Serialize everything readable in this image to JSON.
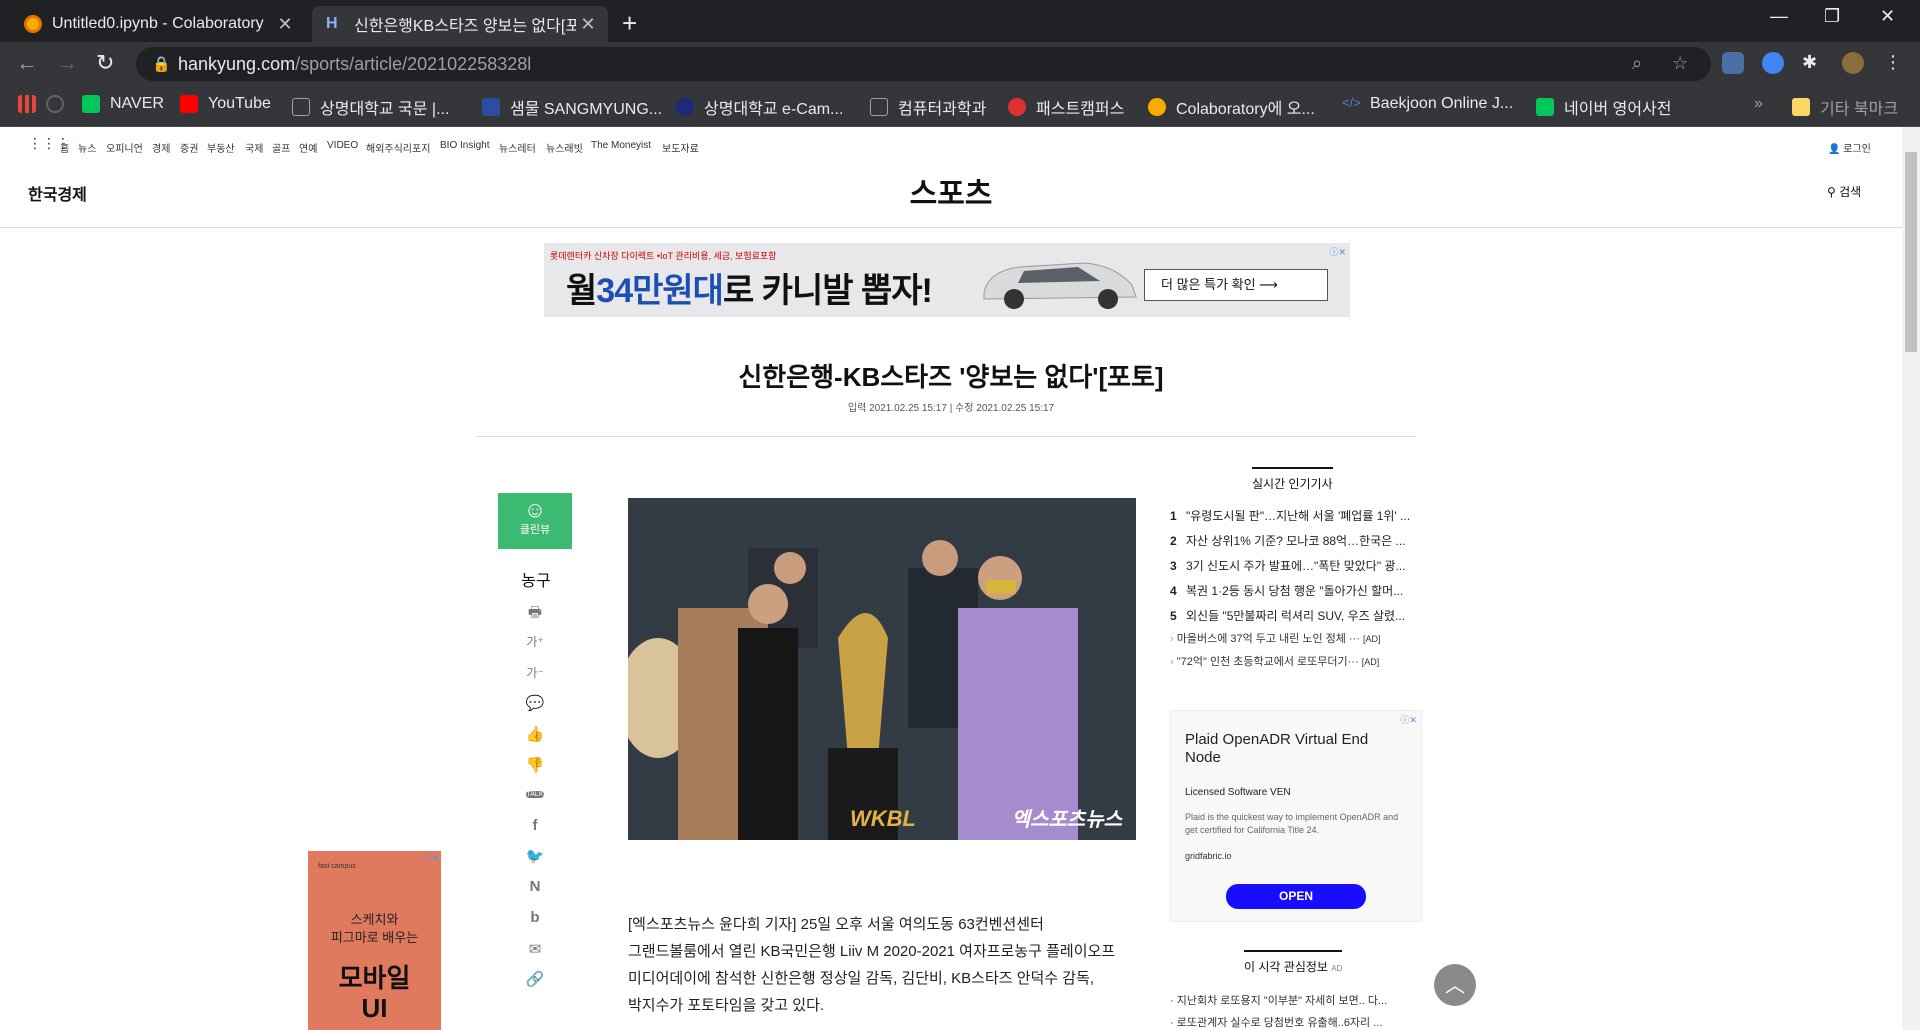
{
  "browser": {
    "tabs": [
      {
        "title": "Untitled0.ipynb - Colaboratory",
        "active": false,
        "favicon": "colab-icon"
      },
      {
        "title": "신한은행KB스타즈 양보는 없다[포",
        "active": true,
        "favicon": "hankyung-h-icon"
      }
    ],
    "close_glyph": "✕",
    "newtab_glyph": "+",
    "url_domain": "hankyung.com",
    "url_path": "/sports/article/202102258328l",
    "bookmarks": [
      {
        "label": "",
        "icon": "apps-grid-icon"
      },
      {
        "label": "",
        "icon": "blocked-icon"
      },
      {
        "label": "NAVER",
        "icon": "naver-icon"
      },
      {
        "label": "YouTube",
        "icon": "youtube-icon"
      },
      {
        "label": "상명대학교 국문 |...",
        "icon": "school-icon"
      },
      {
        "label": "샘물 SANGMYUNG...",
        "icon": "sangmyung-icon"
      },
      {
        "label": "상명대학교 e-Cam...",
        "icon": "ecampus-icon"
      },
      {
        "label": "컴퓨터과학과",
        "icon": "school-icon"
      },
      {
        "label": "패스트캠퍼스",
        "icon": "fastcampus-icon"
      },
      {
        "label": "Colaboratory에 오...",
        "icon": "colab-icon"
      },
      {
        "label": "Baekjoon Online J...",
        "icon": "code-icon"
      },
      {
        "label": "네이버 영어사전",
        "icon": "naver-dict-icon"
      },
      {
        "label": "기타 북마크",
        "icon": "folder-icon"
      }
    ],
    "more_bookmarks_glyph": "»"
  },
  "site": {
    "topnav": [
      "홈",
      "뉴스",
      "오피니언",
      "경제",
      "증권",
      "부동산",
      "국제",
      "골프",
      "연예",
      "VIDEO",
      "해외주식리포지",
      "BIO Insight",
      "뉴스레터",
      "뉴스래빗",
      "The Moneyist",
      "보도자료"
    ],
    "login": "로그인",
    "logo": "한국경제",
    "section": "스포츠",
    "search": "검색"
  },
  "banner_ad": {
    "small_text": "롯데렌터카 신차장 다이렉트 •IoT 관리비용, 세금, 보험료포함",
    "headline_prefix": "월",
    "headline_number": "34만원대",
    "headline_suffix": "로 카니발 뽑자!",
    "cta": "더 많은 특가 확인 ⟶"
  },
  "article": {
    "headline": "신한은행-KB스타즈 '양보는 없다'[포토]",
    "date_line": "입력 2021.02.25 15:17 | 수정 2021.02.25 15:17",
    "category": "농구",
    "clean_view": "클린뷰",
    "photo_watermark": "엑스포츠뉴스",
    "photo_logo": "WKBL",
    "body_lines": [
      "[엑스포츠뉴스 윤다희 기자] 25일 오후 서울 여의도동 63컨벤션센터",
      "그랜드볼룸에서 열린 KB국민은행 Liiv M 2020-2021 여자프로농구 플레이오프",
      "미디어데이에 참석한 신한은행 정상일 감독, 김단비, KB스타즈 안덕수 감독,",
      "박지수가 포토타임을 갖고 있다."
    ]
  },
  "tools": [
    "print-icon",
    "font-increase-icon",
    "font-decrease-icon",
    "comment-icon",
    "thumbs-up-icon",
    "thumbs-down-icon",
    "kakaotalk-icon",
    "facebook-icon",
    "twitter-icon",
    "naver-icon",
    "band-icon",
    "email-icon",
    "link-icon"
  ],
  "tool_glyphs": [
    "🖶",
    "가⁺",
    "가⁻",
    "💬",
    "👍",
    "👎",
    "TALK",
    "f",
    "🐦",
    "N",
    "b",
    "✉",
    "🔗"
  ],
  "sidebar": {
    "popular_title": "실시간 인기기사",
    "popular": [
      {
        "rank": "1",
        "text": "\"유령도시될 판\"…지난해 서울 '폐업률 1위' ..."
      },
      {
        "rank": "2",
        "text": "자산 상위1% 기준? 모나코 88억…한국은 ..."
      },
      {
        "rank": "3",
        "text": "3기 신도시 주가 발표에…\"폭탄 맞았다\" 광..."
      },
      {
        "rank": "4",
        "text": "복권 1·2등 동시 당첨 행운 \"돌아가신 할머..."
      },
      {
        "rank": "5",
        "text": "외신들 \"5만불짜리 럭셔리 SUV, 우즈 살렸..."
      }
    ],
    "ad_links": [
      {
        "text": "마을버스에 37억 두고 내린 노인 정체 ···",
        "tag": "[AD]"
      },
      {
        "text": "\"72억\" 인천 초등학교에서 로또무더기···",
        "tag": "[AD]"
      }
    ],
    "plaid_ad": {
      "title": "Plaid OpenADR Virtual End Node",
      "sponsor": "Licensed Software VEN",
      "desc": "Plaid is the quickest way to implement OpenADR and get certified for California Title 24.",
      "domain": "gridfabric.io",
      "button": "OPEN"
    },
    "interest_title": "이 시각 관심정보",
    "interest_ad_tag": "AD",
    "interest": [
      "지난회차 로또용지 \"이부분\" 자세히 보면.. 다...",
      "로또관계자 실수로 당첨번호 유출해..6자리 ..."
    ]
  },
  "side_ad": {
    "brand": "fast campus",
    "line1": "스케치와",
    "line2": "피그마로 배우는",
    "big1": "모바일",
    "big2": "UI"
  }
}
